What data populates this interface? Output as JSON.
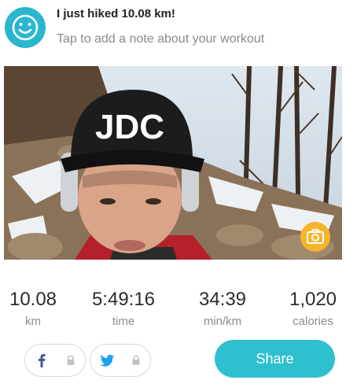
{
  "header": {
    "title": "I just hiked 10.08 km!",
    "note_placeholder": "Tap to add a note about your workout",
    "avatar_icon": "smiley-face-icon",
    "avatar_color": "#29b6cf"
  },
  "photo": {
    "cap_text": "JDC",
    "camera_icon": "camera-icon",
    "camera_button_color": "#f6b52b"
  },
  "stats": [
    {
      "value": "10.08",
      "label": "km"
    },
    {
      "value": "5:49:16",
      "label": "time"
    },
    {
      "value": "34:39",
      "label": "min/km"
    },
    {
      "value": "1,020",
      "label": "calories"
    }
  ],
  "social": {
    "facebook_icon": "facebook-icon",
    "twitter_icon": "twitter-icon",
    "lock_icon": "lock-icon"
  },
  "share": {
    "label": "Share",
    "color": "#2fc0cf"
  }
}
